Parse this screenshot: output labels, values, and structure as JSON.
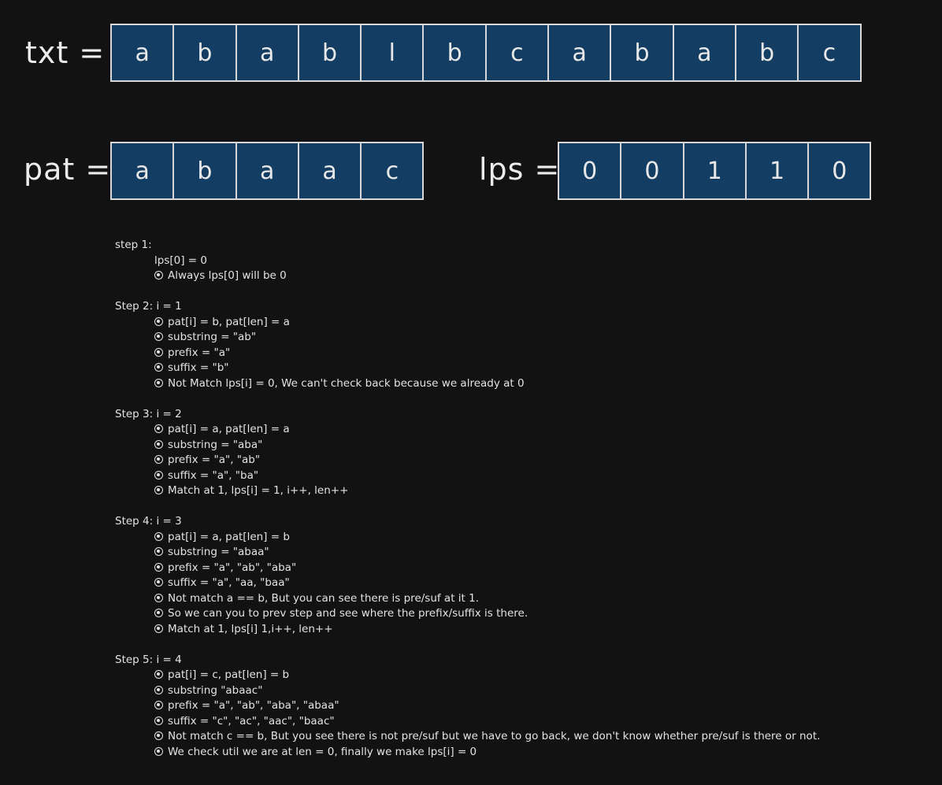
{
  "txt": {
    "label": "txt =",
    "cells": [
      "a",
      "b",
      "a",
      "b",
      "l",
      "b",
      "c",
      "a",
      "b",
      "a",
      "b",
      "c"
    ]
  },
  "pat": {
    "label": "pat =",
    "cells": [
      "a",
      "b",
      "a",
      "a",
      "c"
    ]
  },
  "lps": {
    "label": "lps =",
    "cells": [
      "0",
      "0",
      "1",
      "1",
      "0"
    ]
  },
  "colors": {
    "background": "#121212",
    "cell_fill": "#133d62",
    "cell_border": "#d8d8d8",
    "text": "#e6e6e6"
  },
  "steps": [
    {
      "title": "step 1:",
      "plain": [
        "lps[0] = 0"
      ],
      "bullets": [
        "Always lps[0] will be 0"
      ]
    },
    {
      "title": "Step 2: i = 1",
      "plain": [],
      "bullets": [
        "pat[i] = b, pat[len] = a",
        "substring = \"ab\"",
        "prefix = \"a\"",
        "suffix = \"b\"",
        "Not Match lps[i] = 0, We can't check back because we already at 0"
      ]
    },
    {
      "title": "Step 3: i = 2",
      "plain": [],
      "bullets": [
        "pat[i] = a, pat[len] = a",
        "substring = \"aba\"",
        "prefix = \"a\", \"ab\"",
        "suffix = \"a\", \"ba\"",
        "Match at 1, lps[i] = 1, i++, len++"
      ]
    },
    {
      "title": "Step 4: i = 3",
      "plain": [],
      "bullets": [
        "pat[i] = a, pat[len] = b",
        "substring = \"abaa\"",
        "prefix = \"a\", \"ab\", \"aba\"",
        "suffix = \"a\", \"aa, \"baa\"",
        "Not match a == b, But you can see there is pre/suf at it 1.",
        "So we can you to prev step and see where the prefix/suffix is there.",
        "Match at 1, lps[i] 1,i++, len++"
      ]
    },
    {
      "title": "Step 5: i = 4",
      "plain": [],
      "bullets": [
        "pat[i] = c, pat[len] = b",
        "substring \"abaac\"",
        "prefix = \"a\", \"ab\", \"aba\", \"abaa\"",
        "suffix = \"c\", \"ac\", \"aac\", \"baac\"",
        "Not match c == b, But you see there is not pre/suf but we have to go back, we don't know whether pre/suf is there or not.",
        "We check util we are at len = 0, finally we make lps[i] = 0"
      ]
    }
  ]
}
